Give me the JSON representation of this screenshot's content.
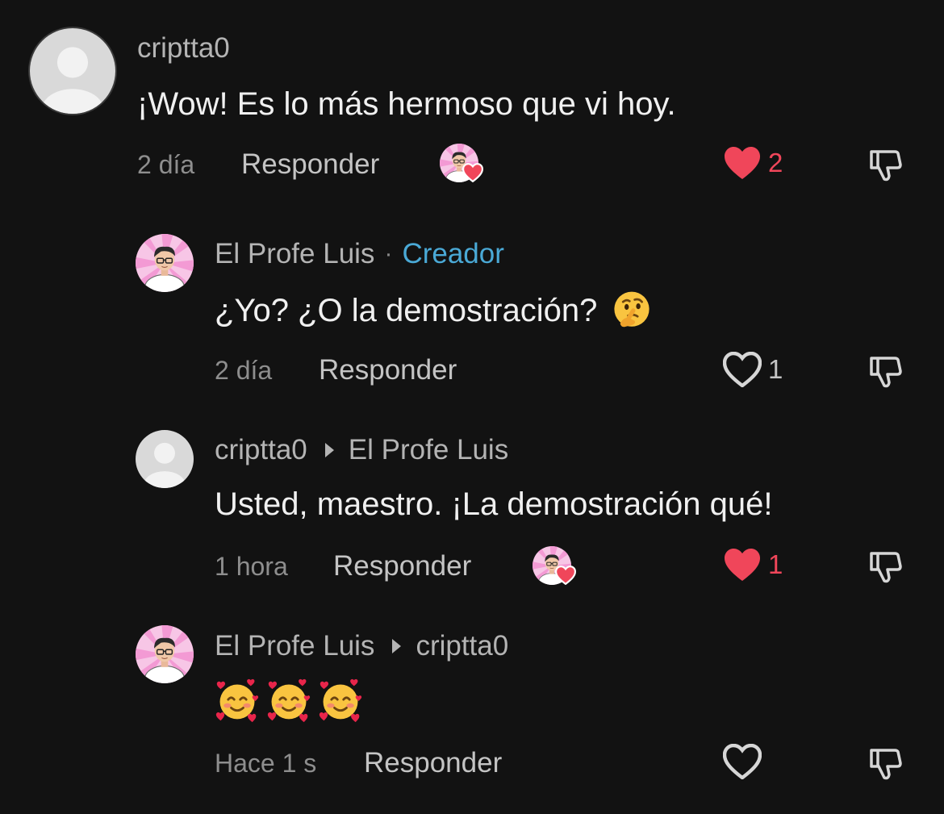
{
  "comments": [
    {
      "username": "criptta0",
      "text": "¡Wow! Es lo más hermoso que vi hoy.",
      "time": "2 día",
      "reply_label": "Responder",
      "liked_by_creator": true,
      "liked": true,
      "like_count": "2",
      "avatar": "default-avatar"
    },
    {
      "username": "El Profe Luis",
      "separator": "·",
      "badge": "Creador",
      "text": "¿Yo? ¿O la demostración?",
      "emoji": "thinking-face",
      "time": "2 día",
      "reply_label": "Responder",
      "liked": false,
      "like_count": "1",
      "avatar": "creator-avatar"
    },
    {
      "username": "criptta0",
      "reply_to": "El Profe Luis",
      "text": "Usted, maestro. ¡La demostración qué!",
      "time": "1 hora",
      "reply_label": "Responder",
      "liked_by_creator": true,
      "liked": true,
      "like_count": "1",
      "avatar": "default-avatar"
    },
    {
      "username": "El Profe Luis",
      "reply_to": "criptta0",
      "emojis": [
        "smiling-face-with-hearts",
        "smiling-face-with-hearts",
        "smiling-face-with-hearts"
      ],
      "time": "Hace 1 s",
      "reply_label": "Responder",
      "liked": false,
      "like_count": "",
      "avatar": "creator-avatar"
    }
  ],
  "colors": {
    "background": "#121212",
    "like_active": "#f0465a",
    "creator_badge": "#4aa9d6",
    "muted_text": "#8e8e8e"
  }
}
